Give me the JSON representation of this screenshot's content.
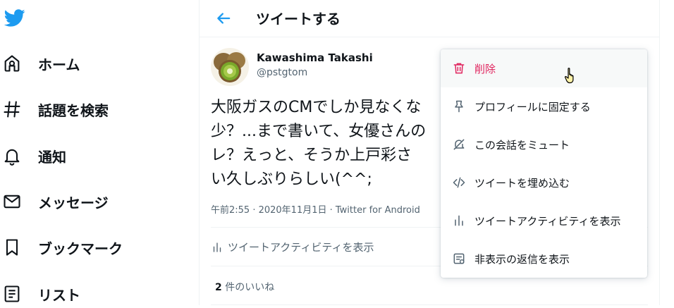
{
  "sidebar": {
    "logo_icon": "twitter-bird-icon",
    "items": [
      {
        "label": "ホーム",
        "icon": "home-icon"
      },
      {
        "label": "話題を検索",
        "icon": "hashtag-icon"
      },
      {
        "label": "通知",
        "icon": "bell-icon"
      },
      {
        "label": "メッセージ",
        "icon": "envelope-icon"
      },
      {
        "label": "ブックマーク",
        "icon": "bookmark-icon"
      },
      {
        "label": "リスト",
        "icon": "list-icon"
      }
    ]
  },
  "header": {
    "title": "ツイートする",
    "back_icon": "arrow-left-icon"
  },
  "tweet": {
    "author_name": "Kawashima Takashi",
    "author_handle": "@pstgtom",
    "text": "大阪ガスのCMでしか見なくな\n少？...まで書いて、女優さんの\nレ？えっと、そうか上戸彩さ\nい久しぶりらしい(^^;",
    "meta": "午前2:55 · 2020年11月1日 · Twitter for Android",
    "activity_label": "ツイートアクティビティを表示",
    "likes_count": "2",
    "likes_label": " 件のいいね"
  },
  "menu": {
    "items": [
      {
        "label": "削除",
        "icon": "trash-icon"
      },
      {
        "label": "プロフィールに固定する",
        "icon": "pin-icon"
      },
      {
        "label": "この会話をミュート",
        "icon": "mute-icon"
      },
      {
        "label": "ツイートを埋め込む",
        "icon": "code-icon"
      },
      {
        "label": "ツイートアクティビティを表示",
        "icon": "bar-chart-icon"
      },
      {
        "label": "非表示の返信を表示",
        "icon": "hidden-replies-icon"
      }
    ]
  },
  "colors": {
    "brand": "#1d9bf0",
    "danger": "#e0245e",
    "muted": "#536471"
  }
}
